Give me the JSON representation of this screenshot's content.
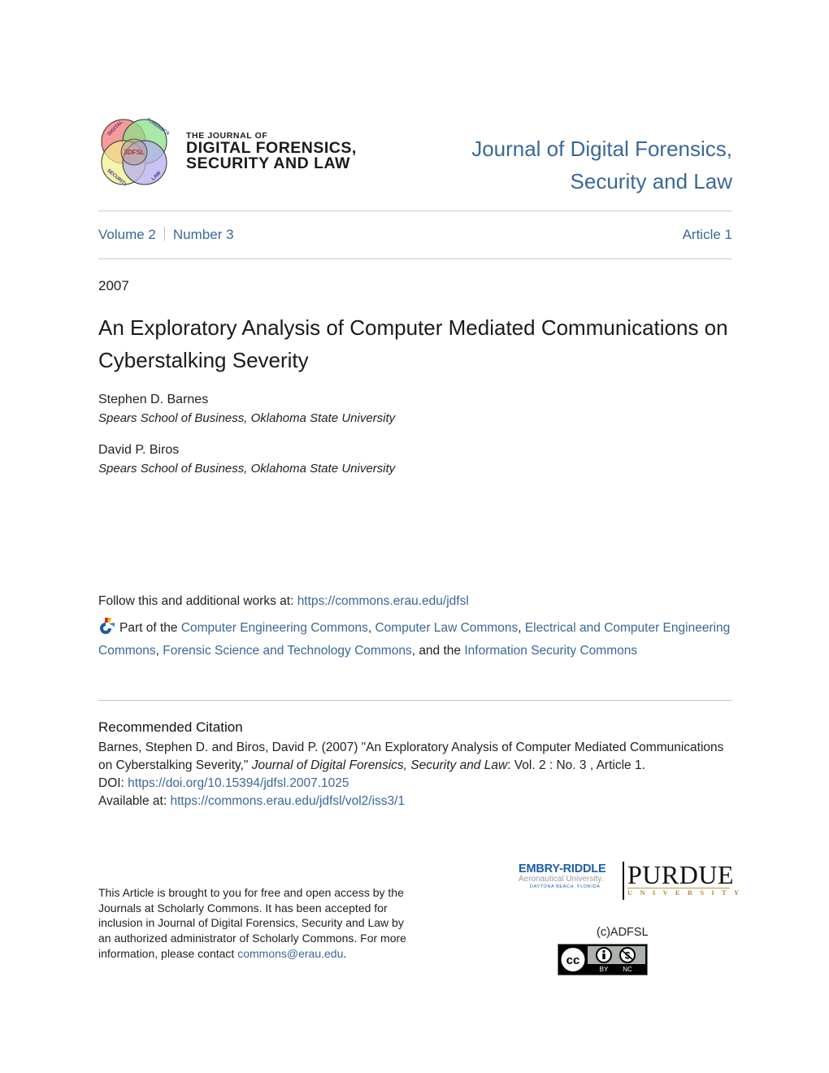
{
  "header": {
    "logo": {
      "small_line": "THE JOURNAL OF",
      "line1": "DIGITAL FORENSICS,",
      "line2": "SECURITY AND LAW",
      "venn_labels": [
        "DIGITAL",
        "FORENSICS",
        "SECURITY",
        "LAW"
      ],
      "center_label": "JDFSL"
    },
    "journal_title_line1": "Journal of Digital Forensics,",
    "journal_title_line2": "Security and Law"
  },
  "issue": {
    "volume": "Volume 2",
    "number": "Number 3",
    "article": "Article 1"
  },
  "article": {
    "year": "2007",
    "title": "An Exploratory Analysis of Computer Mediated Communications on Cyberstalking Severity",
    "authors": [
      {
        "name": "Stephen D. Barnes",
        "affiliation": "Spears School of Business, Oklahoma State University"
      },
      {
        "name": "David P. Biros",
        "affiliation": "Spears School of Business, Oklahoma State University"
      }
    ]
  },
  "follow": {
    "label": "Follow this and additional works at: ",
    "url": "https://commons.erau.edu/jdfsl"
  },
  "part_of": {
    "icon": "bepress-network-icon",
    "prefix": "Part of the ",
    "links": [
      "Computer Engineering Commons",
      "Computer Law Commons",
      "Electrical and Computer Engineering Commons",
      "Forensic Science and Technology Commons",
      "Information Security Commons"
    ],
    "sep": ", ",
    "and_the": ", and the "
  },
  "citation": {
    "heading": "Recommended Citation",
    "text_before": "Barnes, Stephen D. and Biros, David P. (2007) \"An Exploratory Analysis of Computer Mediated Communications on Cyberstalking Severity,\" ",
    "journal_italic": "Journal of Digital Forensics, Security and Law",
    "text_after": ": Vol. 2 : No. 3 , Article 1.",
    "doi_label": "DOI: ",
    "doi_url": "https://doi.org/10.15394/jdfsl.2007.1025",
    "available_label": "Available at: ",
    "available_url": "https://commons.erau.edu/jdfsl/vol2/iss3/1"
  },
  "footer": {
    "access_note": "This Article is brought to you for free and open access by the Journals at Scholarly Commons. It has been accepted for inclusion in Journal of Digital Forensics, Security and Law by an authorized administrator of Scholarly Commons. For more information, please contact ",
    "contact_email": "commons@erau.edu",
    "contact_end": ".",
    "erau": {
      "line1": "EMBRY-RIDDLE",
      "line2": "Aeronautical University.",
      "line3": "DAYTONA BEACH, FLORIDA"
    },
    "purdue": {
      "line1": "PURDUE",
      "line2": "UNIVERSITY"
    },
    "copyright": "(c)ADFSL",
    "license": {
      "icon": "cc-by-nc-icon",
      "by_label": "BY",
      "nc_label": "NC"
    }
  },
  "colors": {
    "link": "#3a6898",
    "text": "#222222",
    "rule": "#c8c8c8"
  }
}
